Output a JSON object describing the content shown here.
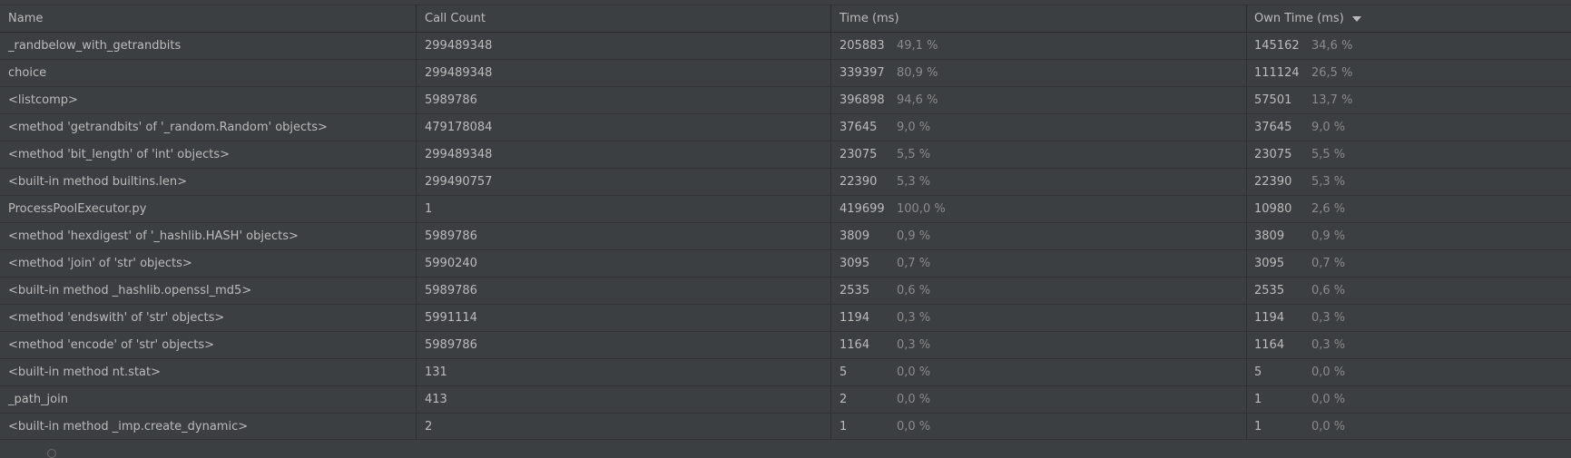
{
  "columns": {
    "name": "Name",
    "call_count": "Call Count",
    "time": "Time (ms)",
    "own_time": "Own Time (ms)"
  },
  "sort": {
    "column": "own_time",
    "direction": "descending",
    "icon": "sort-descending-icon"
  },
  "colors": {
    "background": "#3c3f41",
    "text": "#bbbbbb",
    "percent_text": "#8a8a8a"
  },
  "rows": [
    {
      "name": "_randbelow_with_getrandbits",
      "calls": "299489348",
      "time": "205883",
      "time_pct": "49,1 %",
      "own": "145162",
      "own_pct": "34,6 %"
    },
    {
      "name": "choice",
      "calls": "299489348",
      "time": "339397",
      "time_pct": "80,9 %",
      "own": "111124",
      "own_pct": "26,5 %"
    },
    {
      "name": "<listcomp>",
      "calls": "5989786",
      "time": "396898",
      "time_pct": "94,6 %",
      "own": "57501",
      "own_pct": "13,7 %"
    },
    {
      "name": "<method 'getrandbits' of '_random.Random' objects>",
      "calls": "479178084",
      "time": "37645",
      "time_pct": "9,0 %",
      "own": "37645",
      "own_pct": "9,0 %"
    },
    {
      "name": "<method 'bit_length' of 'int' objects>",
      "calls": "299489348",
      "time": "23075",
      "time_pct": "5,5 %",
      "own": "23075",
      "own_pct": "5,5 %"
    },
    {
      "name": "<built-in method builtins.len>",
      "calls": "299490757",
      "time": "22390",
      "time_pct": "5,3 %",
      "own": "22390",
      "own_pct": "5,3 %"
    },
    {
      "name": "ProcessPoolExecutor.py",
      "calls": "1",
      "time": "419699",
      "time_pct": "100,0 %",
      "own": "10980",
      "own_pct": "2,6 %"
    },
    {
      "name": "<method 'hexdigest' of '_hashlib.HASH' objects>",
      "calls": "5989786",
      "time": "3809",
      "time_pct": "0,9 %",
      "own": "3809",
      "own_pct": "0,9 %"
    },
    {
      "name": "<method 'join' of 'str' objects>",
      "calls": "5990240",
      "time": "3095",
      "time_pct": "0,7 %",
      "own": "3095",
      "own_pct": "0,7 %"
    },
    {
      "name": "<built-in method _hashlib.openssl_md5>",
      "calls": "5989786",
      "time": "2535",
      "time_pct": "0,6 %",
      "own": "2535",
      "own_pct": "0,6 %"
    },
    {
      "name": "<method 'endswith' of 'str' objects>",
      "calls": "5991114",
      "time": "1194",
      "time_pct": "0,3 %",
      "own": "1194",
      "own_pct": "0,3 %"
    },
    {
      "name": "<method 'encode' of 'str' objects>",
      "calls": "5989786",
      "time": "1164",
      "time_pct": "0,3 %",
      "own": "1164",
      "own_pct": "0,3 %"
    },
    {
      "name": "<built-in method nt.stat>",
      "calls": "131",
      "time": "5",
      "time_pct": "0,0 %",
      "own": "5",
      "own_pct": "0,0 %"
    },
    {
      "name": "_path_join",
      "calls": "413",
      "time": "2",
      "time_pct": "0,0 %",
      "own": "1",
      "own_pct": "0,0 %"
    },
    {
      "name": "<built-in method _imp.create_dynamic>",
      "calls": "2",
      "time": "1",
      "time_pct": "0,0 %",
      "own": "1",
      "own_pct": "0,0 %"
    }
  ]
}
